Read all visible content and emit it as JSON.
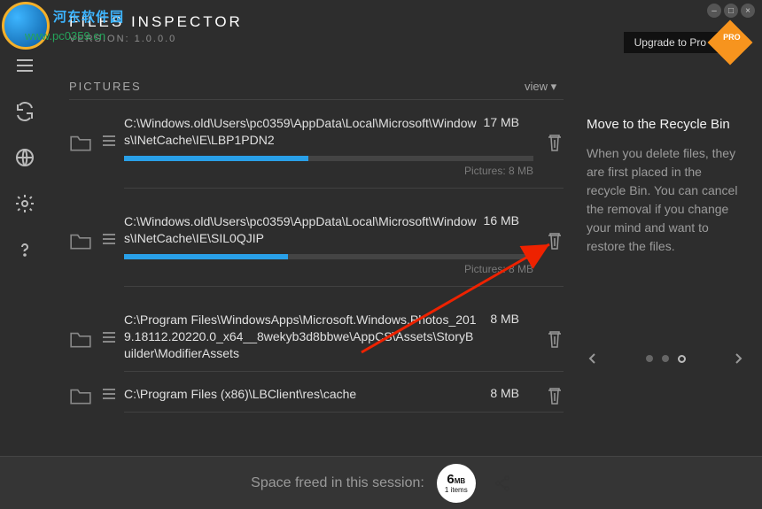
{
  "app": {
    "title": "FILES INSPECTOR",
    "version": "VERSION: 1.0.0.0"
  },
  "watermark": {
    "text": "河东软件园",
    "sub": "www.pc0359.cn"
  },
  "upgrade": {
    "label": "Upgrade to Pro",
    "badge": "PRO"
  },
  "section": {
    "header": "PICTURES",
    "view_label": "view  ▾"
  },
  "rows": [
    {
      "path": "C:\\Windows.old\\Users\\pc0359\\AppData\\Local\\Microsoft\\Windows\\INetCache\\IE\\LBP1PDN2",
      "size": "17 MB",
      "pic_label": "Pictures: 8 MB",
      "fill_pct": 45
    },
    {
      "path": "C:\\Windows.old\\Users\\pc0359\\AppData\\Local\\Microsoft\\Windows\\INetCache\\IE\\SIL0QJIP",
      "size": "16 MB",
      "pic_label": "Pictures: 8 MB",
      "fill_pct": 40
    },
    {
      "path": "C:\\Program Files\\WindowsApps\\Microsoft.Windows.Photos_2019.18112.20220.0_x64__8wekyb3d8bbwe\\AppCS\\Assets\\StoryBuilder\\ModifierAssets",
      "size": "8 MB",
      "pic_label": "",
      "fill_pct": 0
    },
    {
      "path": "C:\\Program Files (x86)\\LBClient\\res\\cache",
      "size": "8 MB",
      "pic_label": "",
      "fill_pct": 0
    }
  ],
  "info": {
    "title": "Move to the Recycle Bin",
    "body": "When you delete files, they are first placed in the recycle Bin. You can cancel the removal if you change your mind and want to restore the files."
  },
  "footer": {
    "label": "Space freed in this session:",
    "value": "6",
    "unit": "MB",
    "items": "1 items"
  }
}
